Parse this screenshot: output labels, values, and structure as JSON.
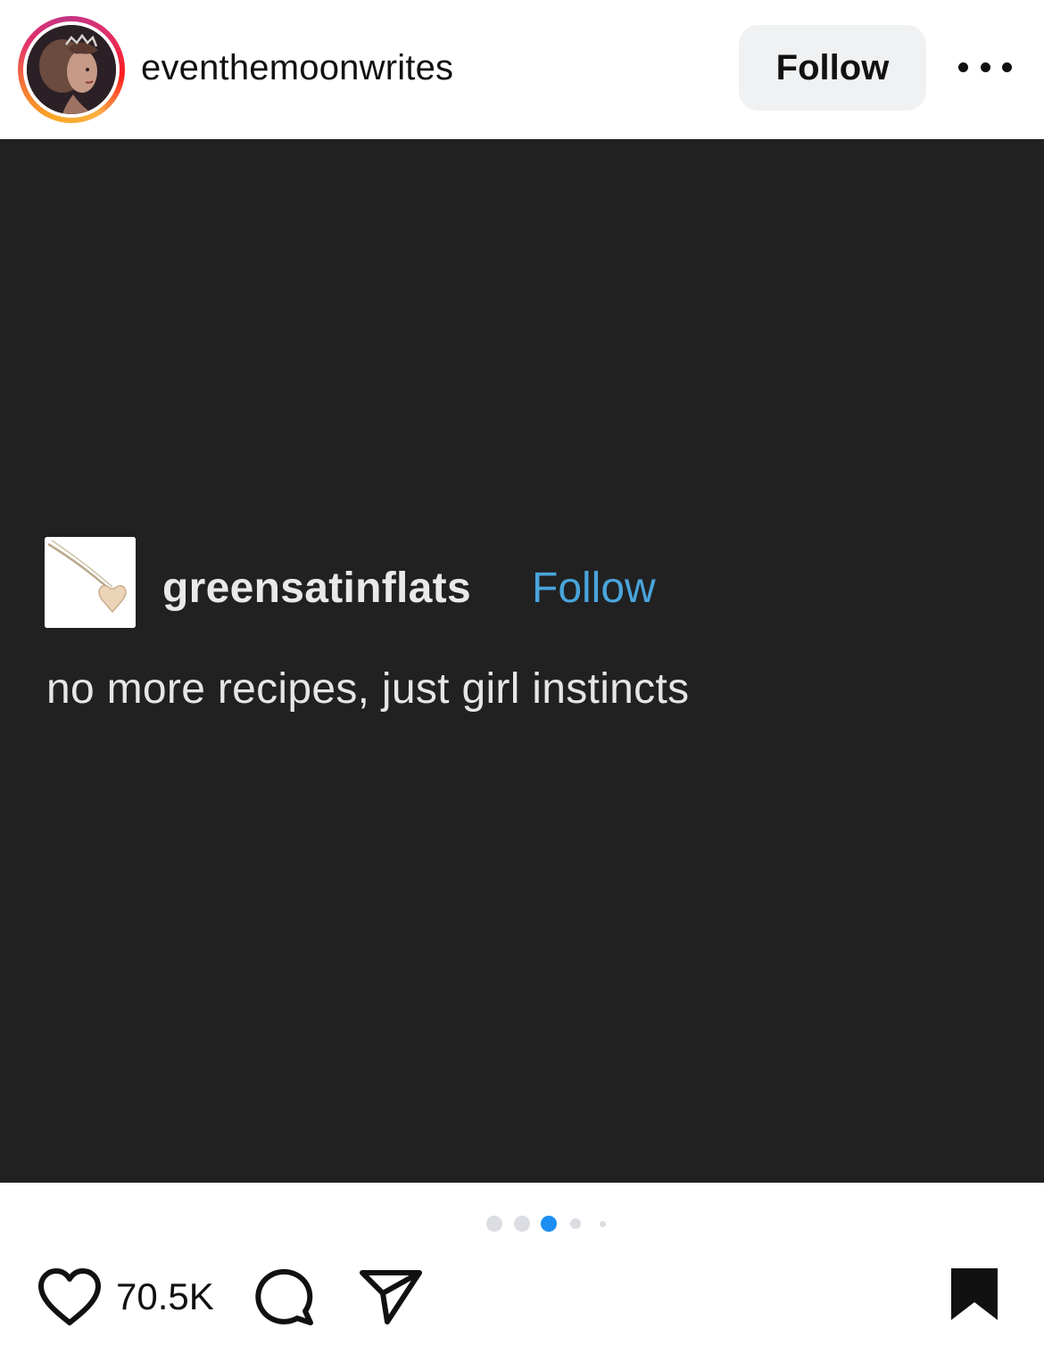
{
  "header": {
    "username": "eventhemoonwrites",
    "follow_label": "Follow",
    "avatar_icon": "profile-portrait-avatar",
    "more_icon": "more-options-icon"
  },
  "post": {
    "embedded": {
      "username": "greensatinflats",
      "follow_label": "Follow",
      "text": "no more recipes, just girl instincts",
      "avatar_icon": "heart-necklace-avatar"
    },
    "carousel": {
      "total_dots": 5,
      "active_index": 2
    }
  },
  "actions": {
    "like_count": "70.5K",
    "like_icon": "heart-icon",
    "comment_icon": "comment-icon",
    "share_icon": "send-icon",
    "save_icon": "bookmark-icon"
  },
  "colors": {
    "post_background": "#212122",
    "tumblr_link": "#4aa5dc",
    "active_dot": "#1c8ef3",
    "inactive_dot": "#dbdde2",
    "follow_button_bg": "#eff1f3"
  }
}
